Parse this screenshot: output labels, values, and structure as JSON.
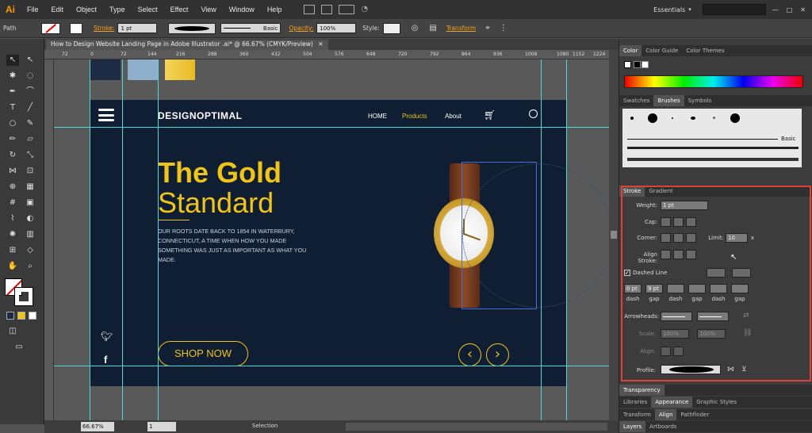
{
  "app": {
    "logo": "Ai",
    "workspace": "Essentials",
    "search_placeholder": ""
  },
  "menu": [
    "File",
    "Edit",
    "Object",
    "Type",
    "Select",
    "Effect",
    "View",
    "Window",
    "Help"
  ],
  "control_bar": {
    "object_type": "Path",
    "stroke_label": "Stroke:",
    "stroke_value": "1 pt",
    "brush_label": "Basic",
    "opacity_label": "Opacity:",
    "opacity_value": "100%",
    "style_label": "Style:",
    "transform_label": "Transform"
  },
  "document": {
    "tab_title": "How to Design Website Landing Page in Adobe Illustrator .ai* @ 66.67% (CMYK/Preview)",
    "ruler_ticks": [
      "72",
      "0",
      "72",
      "144",
      "216",
      "288",
      "360",
      "432",
      "504",
      "576",
      "648",
      "720",
      "792",
      "864",
      "936",
      "1008",
      "1080",
      "1152",
      "1224"
    ]
  },
  "artboard": {
    "swatch_colors": [
      "#0f1e33",
      "#8fb0cc",
      "#f0c419"
    ],
    "brand": "DESIGNOPTIMAL",
    "nav": [
      "HOME",
      "Products",
      "About"
    ],
    "headline_1": "The Gold",
    "headline_2": "Standard",
    "body": "OUR ROOTS DATE BACK TO 1854 IN WATERBURY, CONNECTICUT, A TIME WHEN HOW YOU MADE SOMETHING WAS JUST AS IMPORTANT AS WHAT YOU MADE.",
    "cta": "SHOP NOW",
    "gold": "#e8b923"
  },
  "status": {
    "zoom": "66.67%",
    "page": "1",
    "tool": "Selection"
  },
  "panels": {
    "color_tabs": [
      "Color",
      "Color Guide",
      "Color Themes"
    ],
    "brush_tabs": [
      "Swatches",
      "Brushes",
      "Symbols"
    ],
    "brush_basic": "Basic",
    "stroke_tabs": [
      "Stroke",
      "Gradient"
    ],
    "stroke": {
      "weight_label": "Weight:",
      "weight_value": "1 pt",
      "cap_label": "Cap:",
      "corner_label": "Corner:",
      "limit_label": "Limit:",
      "limit_value": "10",
      "limit_unit": "x",
      "align_label": "Align Stroke:",
      "dashed_label": "Dashed Line",
      "dash_values": [
        "0 pt",
        "9 pt",
        "",
        "",
        "",
        ""
      ],
      "dash_labels": [
        "dash",
        "gap",
        "dash",
        "gap",
        "dash",
        "gap"
      ],
      "arrowheads_label": "Arrowheads:",
      "scale_label": "Scale:",
      "scale_1": "100%",
      "scale_2": "100%",
      "align2_label": "Align:",
      "profile_label": "Profile:"
    },
    "transparency_tab": "Transparency",
    "row_libraries": [
      "Libraries",
      "Appearance",
      "Graphic Styles"
    ],
    "row_transform": [
      "Transform",
      "Align",
      "Pathfinder"
    ],
    "row_layers": [
      "Layers",
      "Artboards"
    ]
  }
}
